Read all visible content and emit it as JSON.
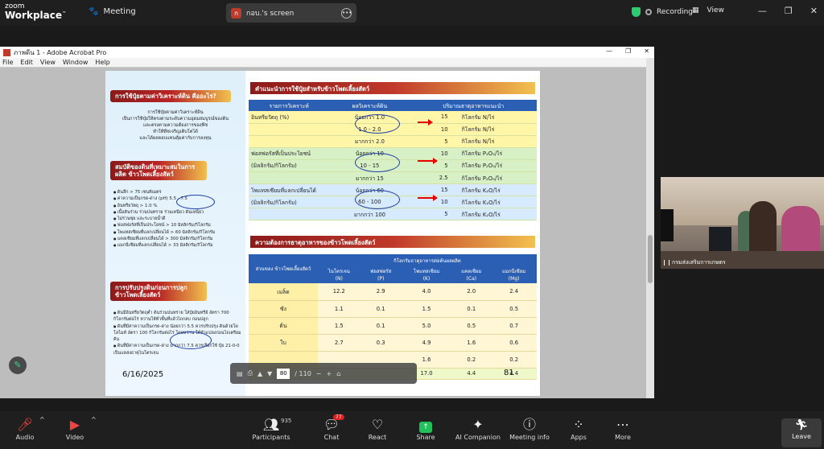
{
  "zoom": {
    "brand_line1": "zoom",
    "brand_line2": "Workplace",
    "meeting_label": "Meeting",
    "share_tab_label": "กอบ.'s screen",
    "share_tab_initial": "ก",
    "recording_label": "Recording",
    "view_label": "View"
  },
  "acrobat": {
    "title": "ภาพดีน 1 - Adobe Acrobat Pro",
    "menu": [
      "File",
      "Edit",
      "View",
      "Window",
      "Help"
    ]
  },
  "slide": {
    "left": {
      "h1": "การใช้ปุ๋ยตามค่าวิเคราะห์ดิน คืออะไร?",
      "p1": [
        "การใช้ปุ๋ยตามค่าวิเคราะห์ดิน",
        "เป็นการใช้ปุ๋ยให้ตรงตามระดับความอุดมสมบูรณ์ของดิน",
        "และตรงตามความต้องการของพืช",
        "ทำให้พืชเจริญเติบโตได้",
        "และได้ผลตอบแทนคุ้มค่ากับการลงทุน"
      ],
      "h2": "สมบัติของดินที่เหมาะสมในการผลิต ข้าวโพดเลี้ยงสัตว์",
      "list2": [
        "ดินลึก > 75 เซนติเมตร",
        "ค่าความเป็นกรด-ด่าง (pH) 5.5 - 7.5",
        "อินทรียวัตถุ > 1.0 %",
        "เนื้อดินร่วน ร่วนปนทราย ร่วนเหนียว ดินเหนียว",
        "ไม่ร่วนซุย และระบายน้ำดี",
        "ฟอสฟอรัสที่เป็นประโยชน์ > 10 มิลลิกรัม/กิโลกรัม",
        "โพแทสเซียมที่แลกเปลี่ยนได้ > 60 มิลลิกรัม/กิโลกรัม",
        "แคลเซียมที่แลกเปลี่ยนได้ > 300 มิลลิกรัม/กิโลกรัม",
        "แมกนีเซียมที่แลกเปลี่ยนได้ > 33 มิลลิกรัม/กิโลกรัม"
      ],
      "h3": "การปรับปรุงดินก่อนการปลูก ข้าวโพดเลี้ยงสัตว์",
      "list3": [
        "ดินมีอินทรียวัตถุต่ำ ดินร่วนปนทราย ใส่ปุ๋ยอินทรีย์ อัตรา 700 กิโลกรัมต่อไร่ หว่านให้ทั่วพื้นที่แล้วไถกลบ ก่อนปลูก",
        "ดินที่มีค่าความเป็นกรด-ด่าง น้อยกว่า 5.5 ควรปรับปรุง ดินด้วยโดโลไมท์ อัตรา 100 กิโลกรัมต่อไร่ โดยหว่าน ให้ทั่วแปลงก่อนไถเตรียมดิน",
        "ดินที่มีค่าความเป็นกรด-ด่าง มากกว่า 7.5 ควรเลือกใช้ ปุ๋ย 21-0-0 เป็นแหล่งธาตุไนโตรเจน"
      ]
    },
    "right": {
      "title1": "คำแนะนำการใช้ปุ๋ยสำหรับข้าวโพดเลี้ยงสัตว์",
      "t1_headers": [
        "รายการวิเคราะห์",
        "ผลวิเคราะห์ดิน",
        "ปริมาณธาตุอาหารแนะนำ"
      ],
      "t1_rows": [
        {
          "item": "อินทรียวัตถุ (%)",
          "result": "น้อยกว่า 1.0",
          "amount": "15",
          "unit": "กิโลกรัม N/ไร่",
          "cls": "g1"
        },
        {
          "item": "",
          "result": "1.0 - 2.0",
          "amount": "10",
          "unit": "กิโลกรัม N/ไร่",
          "cls": "g1"
        },
        {
          "item": "",
          "result": "มากกว่า 2.0",
          "amount": "5",
          "unit": "กิโลกรัม N/ไร่",
          "cls": "g1"
        },
        {
          "item": "ฟอสฟอรัสที่เป็นประโยชน์",
          "result": "น้อยกว่า 10",
          "amount": "10",
          "unit": "กิโลกรัม P₂O₅/ไร่",
          "cls": "g2"
        },
        {
          "item": "(มิลลิกรัม/กิโลกรัม)",
          "result": "10 - 15",
          "amount": "5",
          "unit": "กิโลกรัม P₂O₅/ไร่",
          "cls": "g2"
        },
        {
          "item": "",
          "result": "มากกว่า 15",
          "amount": "2.5",
          "unit": "กิโลกรัม P₂O₅/ไร่",
          "cls": "g2"
        },
        {
          "item": "โพแทสเซียมที่แลกเปลี่ยนได้",
          "result": "น้อยกว่า 60",
          "amount": "15",
          "unit": "กิโลกรัม K₂O/ไร่",
          "cls": "g3"
        },
        {
          "item": "(มิลลิกรัม/กิโลกรัม)",
          "result": "60 - 100",
          "amount": "10",
          "unit": "กิโลกรัม K₂O/ไร่",
          "cls": "g3"
        },
        {
          "item": "",
          "result": "มากกว่า 100",
          "amount": "5",
          "unit": "กิโลกรัม K₂O/ไร่",
          "cls": "g3"
        }
      ],
      "title2": "ความต้องการธาตุอาหารของข้าวโพดเลี้ยงสัตว์",
      "t2_head_part": "ส่วนของ ข้าวโพดเลี้ยงสัตว์",
      "t2_head_group": "กิโลกรัมธาตุอาหารต่อต้นผลผลิต",
      "t2_cols": [
        {
          "name": "ไนโตรเจน",
          "sym": "(N)"
        },
        {
          "name": "ฟอสฟอรัส",
          "sym": "(P)"
        },
        {
          "name": "โพแทสเซียม",
          "sym": "(K)"
        },
        {
          "name": "แคลเซียม",
          "sym": "(Ca)"
        },
        {
          "name": "แมกนีเซียม",
          "sym": "(Mg)"
        }
      ],
      "t2_rows": [
        {
          "part": "เมล็ด",
          "v": [
            "12.2",
            "2.9",
            "4.0",
            "2.0",
            "2.4"
          ]
        },
        {
          "part": "ซัง",
          "v": [
            "1.1",
            "0.1",
            "1.5",
            "0.1",
            "0.5"
          ]
        },
        {
          "part": "ต้น",
          "v": [
            "1.5",
            "0.1",
            "5.0",
            "0.5",
            "0.7"
          ]
        },
        {
          "part": "ใบ",
          "v": [
            "2.7",
            "0.3",
            "4.9",
            "1.6",
            "0.6"
          ]
        },
        {
          "part": "",
          "v": [
            "",
            "",
            "1.6",
            "0.2",
            "0.2"
          ]
        },
        {
          "part": "",
          "v": [
            "",
            "",
            "17.0",
            "4.4",
            "4.4"
          ]
        }
      ]
    },
    "datestamp": "6/16/2025",
    "page_number": "81"
  },
  "pdf_toolbar": {
    "page": "80",
    "total": "/ 110"
  },
  "video": {
    "name": "กรมส่งเสริมการเกษตร"
  },
  "bottom": {
    "audio": "Audio",
    "video": "Video",
    "participants": "Participants",
    "participants_count": "935",
    "chat": "Chat",
    "chat_badge": "77",
    "react": "React",
    "share": "Share",
    "ai": "AI Companion",
    "info": "Meeting info",
    "apps": "Apps",
    "more": "More",
    "leave": "Leave"
  }
}
